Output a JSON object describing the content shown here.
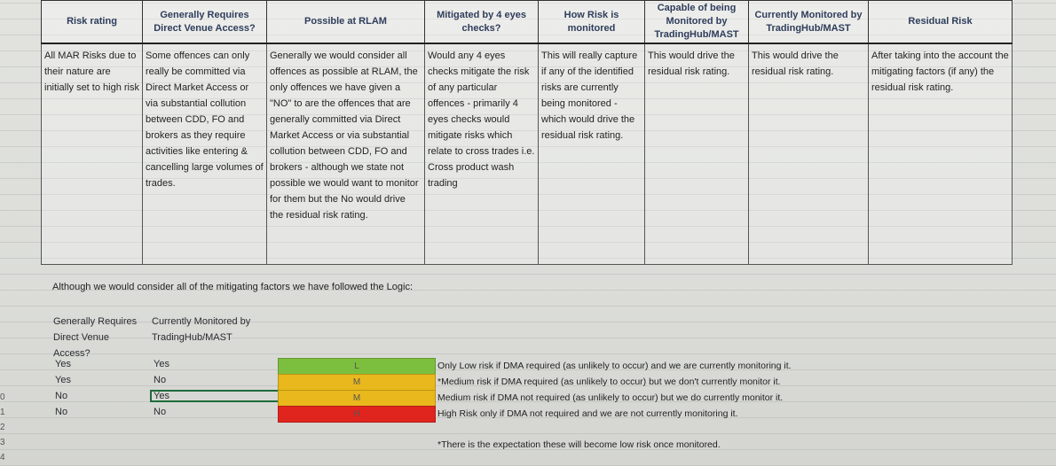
{
  "headers": [
    "Risk rating",
    "Generally Requires Direct Venue Access?",
    "Possible at RLAM",
    "Mitigated by 4 eyes checks?",
    "How Risk is monitored",
    "Capable of being Monitored by TradingHub/MAST",
    "Currently Monitored by TradingHub/MAST",
    "Residual Risk"
  ],
  "cells": [
    "All MAR Risks due to their nature are initially set to high risk",
    "Some offences can only really be committed via Direct Market Access or via substantial collution between CDD, FO and brokers as they require activities like entering & cancelling large volumes of trades.",
    "Generally we would consider all offences as possible at RLAM, the only offences we have given a \"NO\" to are the offences that are generally committed via Direct Market Access or via substantial collution between CDD, FO and brokers - although we state not possible we would want to monitor for them but the No would drive the residual risk rating.",
    "Would any 4 eyes checks mitigate the risk of any particular offences - primarily 4 eyes checks would mitigate risks which relate to cross trades i.e. Cross product wash trading",
    "This will really capture if any of the identified risks are currently being monitored - which would drive the residual risk rating.",
    "This would drive the residual risk rating.",
    "This would drive the residual risk rating.",
    "After taking into the account the mitigating factors (if any) the residual risk rating."
  ],
  "logic_text": "Although we would consider all of the mitigating factors we have followed the Logic:",
  "logic_table": {
    "col1_header": "Generally Requires Direct Venue Access?",
    "col2_header": "Currently Monitored by TradingHub/MAST",
    "rows": [
      {
        "direct": "Yes",
        "monitored": "Yes",
        "level": "L",
        "color": "#7cbf3e",
        "description": "Only Low risk if DMA required (as unlikely to occur) and we are currently monitoring it."
      },
      {
        "direct": "Yes",
        "monitored": "No",
        "level": "M",
        "color": "#e8b81c",
        "description": "*Medium risk if DMA required (as unlikely to occur) but we don't currently monitor it."
      },
      {
        "direct": "No",
        "monitored": "Yes",
        "level": "M",
        "color": "#e8b81c",
        "description": "Medium risk if DMA not required (as unlikely to occur) but we do currently monitor it."
      },
      {
        "direct": "No",
        "monitored": "No",
        "level": "H",
        "color": "#e0241e",
        "description": "High Risk only if DMA not required and we are not currently monitoring it."
      }
    ]
  },
  "note": "*There is the expectation these will become low risk once monitored.",
  "row_numbers": [
    "0",
    "1",
    "2",
    "3",
    "4"
  ]
}
